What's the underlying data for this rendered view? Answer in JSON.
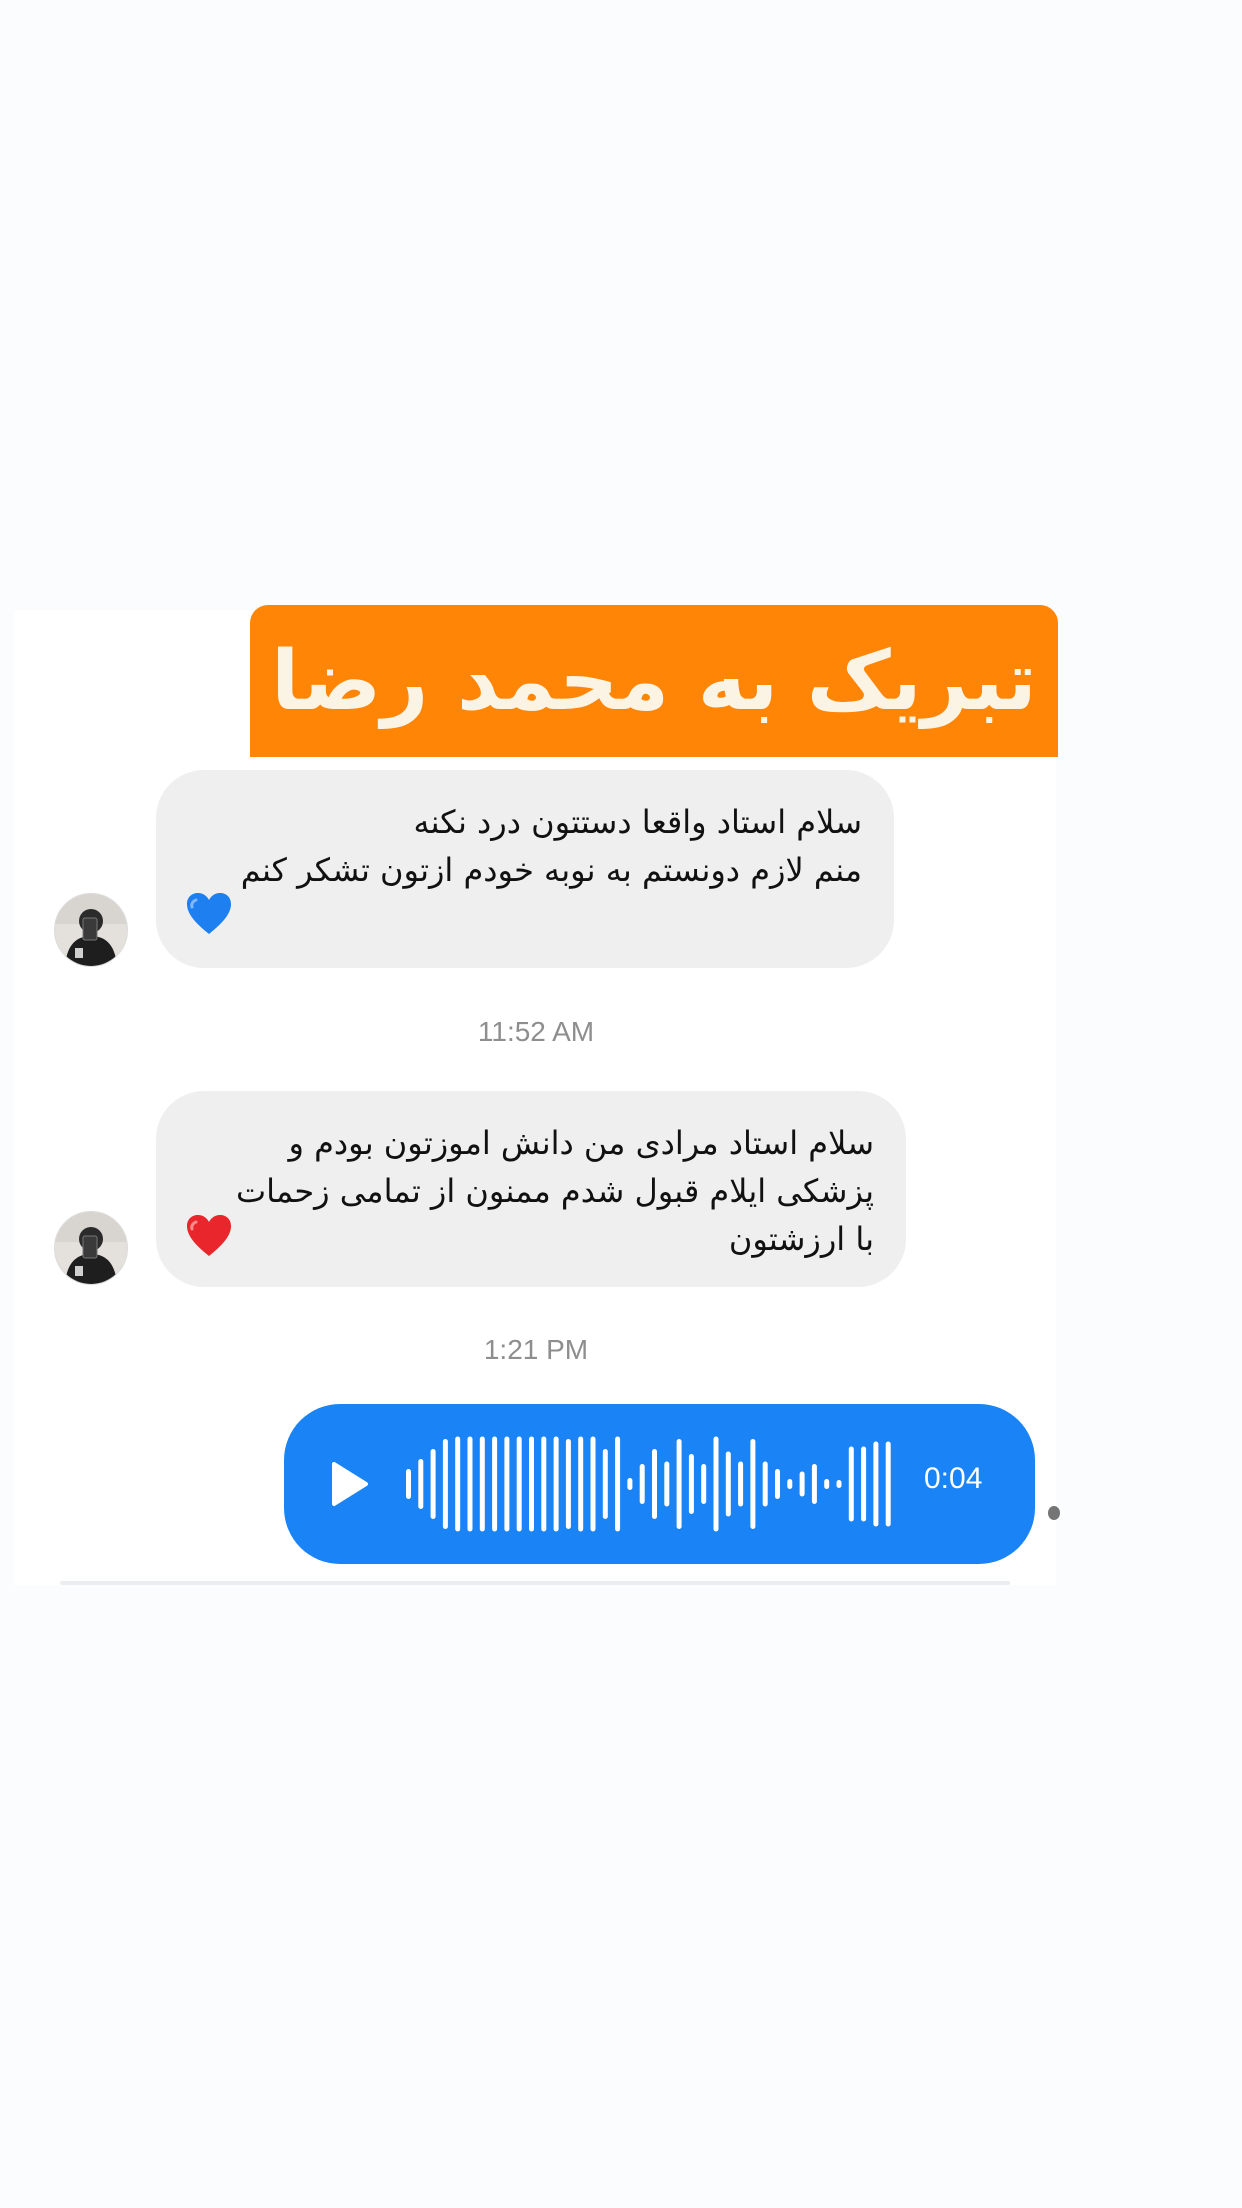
{
  "title_banner": {
    "text": "تبریک به محمد رضا",
    "color": "#ff8506"
  },
  "messages": [
    {
      "sender": "contact",
      "text": "سلام استاد واقعا دستتون درد نکنه\nمنم لازم دونستم به نوبه خودم ازتون تشکر کنم",
      "emoji": "blue-heart-icon"
    },
    {
      "sender": "contact",
      "text": "سلام استاد مرادی  من دانش اموزتون بودم و\nپزشکی ایلام قبول شدم ممنون از تمامی زحمات\nبا ارزشتون",
      "emoji": "red-heart-icon"
    }
  ],
  "timestamps": {
    "first": "11:52 AM",
    "second": "1:21 PM"
  },
  "voice_message": {
    "sender": "me",
    "duration": "0:04",
    "color": "#1a83f5",
    "icon": "play-icon"
  },
  "colors": {
    "incoming_bubble": "#efefef",
    "page_background": "#fbfcfe",
    "timestamp": "#8e8e8e"
  }
}
